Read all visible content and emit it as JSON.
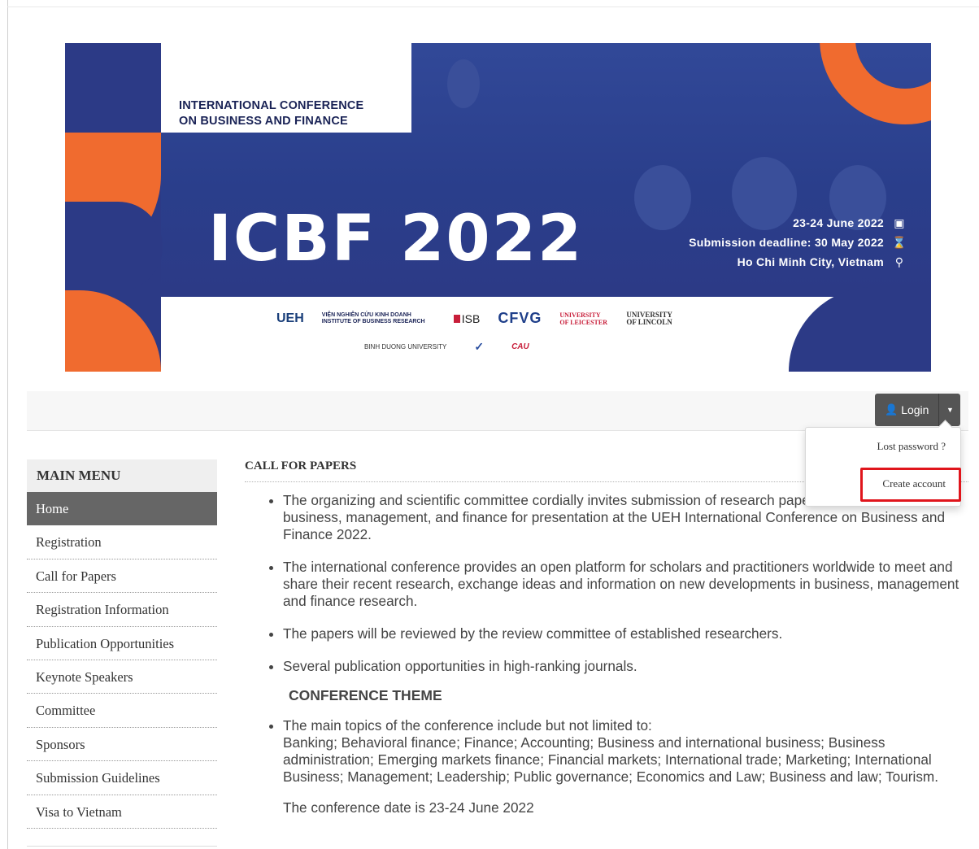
{
  "banner": {
    "title_line1": "INTERNATIONAL CONFERENCE",
    "title_line2": "ON BUSINESS AND FINANCE",
    "big_title": "ICBF 2022",
    "date": "23-24 June 2022",
    "deadline": "Submission deadline: 30 May 2022",
    "location": "Ho Chi Minh City, Vietnam",
    "logos_row1": [
      "UEH",
      "VIỆN NGHIÊN CỨU KINH DOANH INSTITUTE OF BUSINESS RESEARCH",
      "ISB",
      "CFVG",
      "UNIVERSITY OF LEICESTER",
      "UNIVERSITY OF LINCOLN"
    ],
    "logos_row2": [
      "BINH DUONG UNIVERSITY",
      "CAU"
    ]
  },
  "navbar": {
    "login_label": "Login",
    "dropdown": {
      "lost_password": "Lost password ?",
      "create_account": "Create account"
    }
  },
  "sidebar": {
    "title": "MAIN MENU",
    "items": [
      {
        "label": "Home"
      },
      {
        "label": "Registration"
      },
      {
        "label": "Call for Papers"
      },
      {
        "label": "Registration Information"
      },
      {
        "label": "Publication Opportunities"
      },
      {
        "label": "Keynote Speakers"
      },
      {
        "label": "Committee"
      },
      {
        "label": "Sponsors"
      },
      {
        "label": "Submission Guidelines"
      },
      {
        "label": "Visa to Vietnam"
      }
    ]
  },
  "content": {
    "heading": "CALL FOR PAPERS",
    "bullets": [
      "The organizing and scientific committee cordially invites submission of research papers in all areas of business, management, and finance for presentation at the UEH International Conference on Business and Finance 2022.",
      "The international conference provides an open platform for scholars and practitioners worldwide to meet and share their recent research, exchange ideas and information on new developments in business, management and finance research.",
      "The papers will be reviewed by the review committee of established researchers.",
      "Several publication opportunities in high-ranking journals."
    ],
    "theme_heading": "CONFERENCE THEME",
    "topics_intro": "The main topics of the conference include but not limited to:",
    "topics": "Banking; Behavioral finance; Finance; Accounting;  Business and international business; Business administration; Emerging markets finance;  Financial markets; International trade;  Marketing; International Business;  Management;  Leadership; Public governance; Economics and Law; Business and law; Tourism.",
    "conference_date": "The conference date is 23-24 June 2022"
  }
}
